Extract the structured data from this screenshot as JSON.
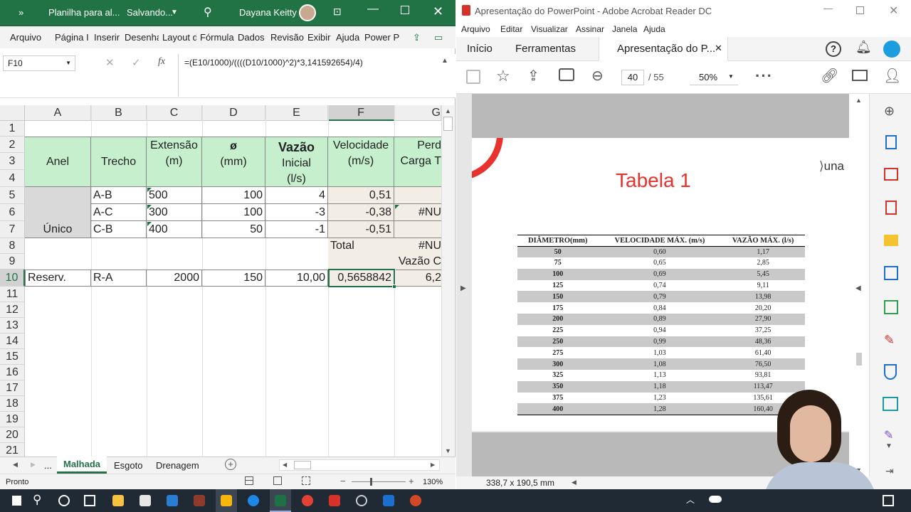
{
  "excel": {
    "title": "Planilha para al...",
    "saving": "Salvando...",
    "user": "Dayana Keitty",
    "expand": "»",
    "menu": [
      "Arquivo",
      "Página I",
      "Inserir",
      "Desenha",
      "Layout d",
      "Fórmula",
      "Dados",
      "Revisão",
      "Exibir",
      "Ajuda",
      "Power P"
    ],
    "namebox": "F10",
    "fx": "fx",
    "formula": "=(E10/1000)/((((D10/1000)^2)*3,141592654)/4)",
    "columns": [
      "A",
      "B",
      "C",
      "D",
      "E",
      "F",
      "G"
    ],
    "rows": [
      "1",
      "2",
      "3",
      "4",
      "5",
      "6",
      "7",
      "8",
      "9",
      "10",
      "11",
      "12",
      "13",
      "14",
      "15",
      "16",
      "17",
      "18",
      "19",
      "20",
      "21"
    ],
    "headers": {
      "anel": "Anel",
      "trecho": "Trecho",
      "ext1": "Extensão",
      "ext2": "(m)",
      "diam1": "ø",
      "diam2": "(mm)",
      "vaz1": "Vazão",
      "vaz2": "Inicial",
      "vaz3": "(l/s)",
      "vel1": "Velocidade",
      "vel2": "(m/s)",
      "perd1": "Perd",
      "perd2": "Carga T"
    },
    "data": [
      {
        "trecho": "A-B",
        "ext": "500",
        "diam": "100",
        "vaz": "4",
        "vel": "0,51",
        "g": ""
      },
      {
        "trecho": "A-C",
        "ext": "300",
        "diam": "100",
        "vaz": "-3",
        "vel": "-0,38",
        "g": "#NU"
      },
      {
        "trecho": "C-B",
        "ext": "400",
        "diam": "50",
        "vaz": "-1",
        "vel": "-0,51",
        "g": ""
      }
    ],
    "unico": "Único",
    "total": "Total",
    "g8": "#NU",
    "g9": "Vazão C",
    "row10": {
      "a": "Reserv.",
      "b": "R-A",
      "c": "2000",
      "d": "150",
      "e": "10,00",
      "f": "0,5658842",
      "g": "6,2"
    },
    "sheets": [
      "...",
      "Malhada",
      "Esgoto",
      "Drenagem"
    ],
    "status": "Pronto",
    "zoom": "130%"
  },
  "acrobat": {
    "title": "Apresentação do PowerPoint - Adobe Acrobat Reader DC",
    "menu": [
      "Arquivo",
      "Editar",
      "Visualizar",
      "Assinar",
      "Janela",
      "Ajuda"
    ],
    "tabs": [
      "Início",
      "Ferramentas",
      "Apresentação do P..."
    ],
    "page": "40",
    "pages": "/  55",
    "zoom": "50%",
    "slide_title": "Tabela 1",
    "logo": "una",
    "table_headers": [
      "DIÂMETRO(mm)",
      "VELOCIDADE MÁX. (m/s)",
      "VAZÃO MÁX. (l/s)"
    ],
    "table_rows": [
      [
        "50",
        "0,60",
        "1,17"
      ],
      [
        "75",
        "0,65",
        "2,85"
      ],
      [
        "100",
        "0,69",
        "5,45"
      ],
      [
        "125",
        "0,74",
        "9,11"
      ],
      [
        "150",
        "0,79",
        "13,98"
      ],
      [
        "175",
        "0,84",
        "20,20"
      ],
      [
        "200",
        "0,89",
        "27,90"
      ],
      [
        "225",
        "0,94",
        "37,25"
      ],
      [
        "250",
        "0,99",
        "48,36"
      ],
      [
        "275",
        "1,03",
        "61,40"
      ],
      [
        "300",
        "1,08",
        "76,50"
      ],
      [
        "325",
        "1,13",
        "93,81"
      ],
      [
        "350",
        "1,18",
        "113,47"
      ],
      [
        "375",
        "1,23",
        "135,61"
      ],
      [
        "400",
        "1,28",
        "160,40"
      ]
    ],
    "dims": "338,7 x 190,5 mm"
  },
  "colors": {
    "excel_green": "#217346",
    "header_green": "#c6efce",
    "accent_red": "#e8322d"
  }
}
